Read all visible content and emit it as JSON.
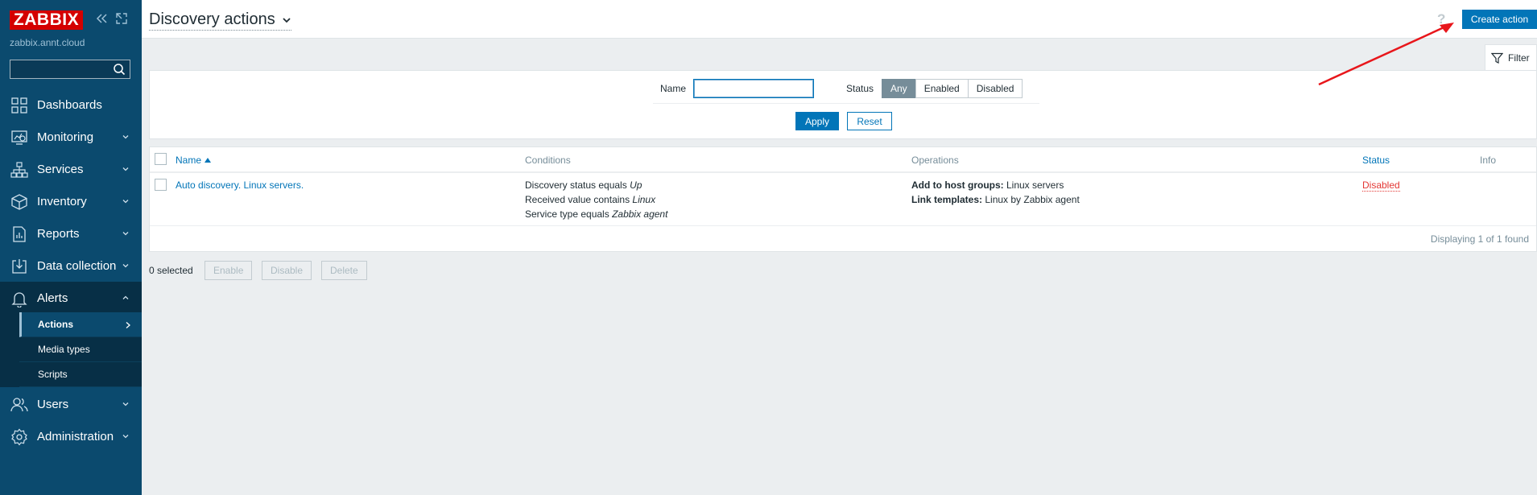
{
  "sidebar": {
    "logo": "ZABBIX",
    "server_name": "zabbix.annt.cloud",
    "search_placeholder": "",
    "items": [
      {
        "label": "Dashboards",
        "icon": "dashboards-icon"
      },
      {
        "label": "Monitoring",
        "icon": "monitoring-icon"
      },
      {
        "label": "Services",
        "icon": "services-icon"
      },
      {
        "label": "Inventory",
        "icon": "inventory-icon"
      },
      {
        "label": "Reports",
        "icon": "reports-icon"
      },
      {
        "label": "Data collection",
        "icon": "data-collection-icon"
      },
      {
        "label": "Alerts",
        "icon": "alerts-icon"
      },
      {
        "label": "Users",
        "icon": "users-icon"
      },
      {
        "label": "Administration",
        "icon": "administration-icon"
      }
    ],
    "alerts_submenu": [
      {
        "label": "Actions",
        "active": true
      },
      {
        "label": "Media types",
        "active": false
      },
      {
        "label": "Scripts",
        "active": false
      }
    ]
  },
  "header": {
    "title": "Discovery actions",
    "help": "?",
    "create_button": "Create action"
  },
  "filter": {
    "tab_label": "Filter",
    "name_label": "Name",
    "name_value": "",
    "status_label": "Status",
    "status_options": [
      "Any",
      "Enabled",
      "Disabled"
    ],
    "status_selected": "Any",
    "apply": "Apply",
    "reset": "Reset"
  },
  "table": {
    "columns": {
      "name": "Name",
      "conditions": "Conditions",
      "operations": "Operations",
      "status": "Status",
      "info": "Info"
    },
    "rows": [
      {
        "name": "Auto discovery. Linux servers.",
        "conditions": [
          {
            "text": "Discovery status equals ",
            "value": "Up"
          },
          {
            "text": "Received value contains ",
            "value": "Linux"
          },
          {
            "text": "Service type equals ",
            "value": "Zabbix agent"
          }
        ],
        "operations": [
          {
            "label": "Add to host groups:",
            "value": " Linux servers"
          },
          {
            "label": "Link templates:",
            "value": " Linux by Zabbix agent"
          }
        ],
        "status": "Disabled"
      }
    ],
    "footer": "Displaying 1 of 1 found"
  },
  "mass_actions": {
    "selected": "0 selected",
    "enable": "Enable",
    "disable": "Disable",
    "delete": "Delete"
  },
  "colors": {
    "sidebar_bg": "#0b4a6e",
    "accent": "#0275b8",
    "logo_red": "#d40000",
    "status_disabled": "#e33734",
    "annotation_arrow": "#e8161b"
  }
}
